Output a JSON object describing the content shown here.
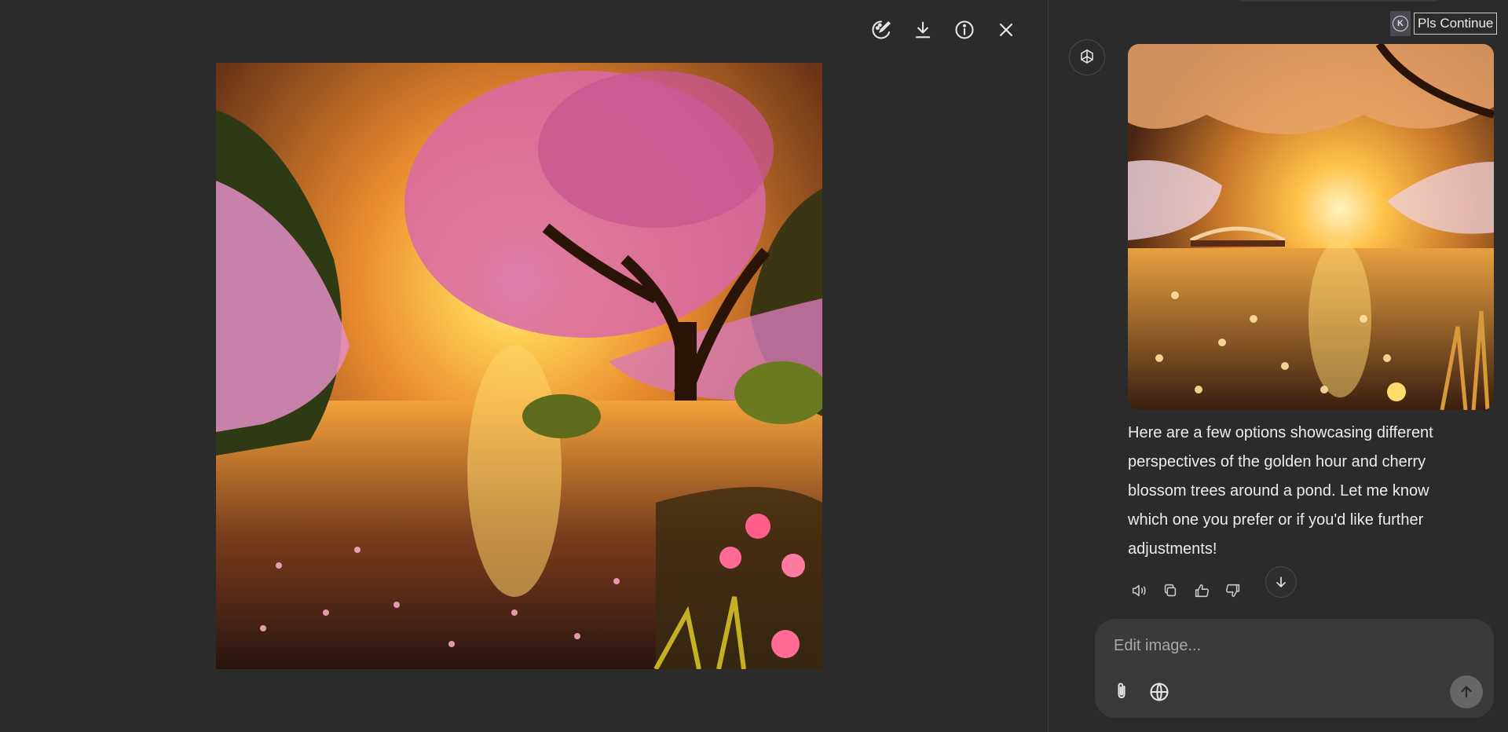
{
  "viewer": {
    "toolbar": [
      {
        "name": "edit-image-button",
        "icon": "palette-edit-icon"
      },
      {
        "name": "download-button",
        "icon": "download-icon"
      },
      {
        "name": "info-button",
        "icon": "info-icon"
      },
      {
        "name": "close-button",
        "icon": "close-icon"
      }
    ]
  },
  "extension": {
    "badge": "K",
    "label": "Pls Continue"
  },
  "chat": {
    "message": "Here are a few options showcasing different perspectives of the golden hour and cherry blossom trees around a pond. Let me know which one you prefer or if you'd like further adjustments!",
    "actions": [
      "read-aloud-icon",
      "copy-icon",
      "thumbs-up-icon",
      "thumbs-down-icon"
    ],
    "composer": {
      "placeholder": "Edit image..."
    }
  },
  "colors": {
    "background": "#2b2b2b",
    "composer": "#3a3a3a",
    "send": "#676767",
    "text": "#ececec"
  }
}
